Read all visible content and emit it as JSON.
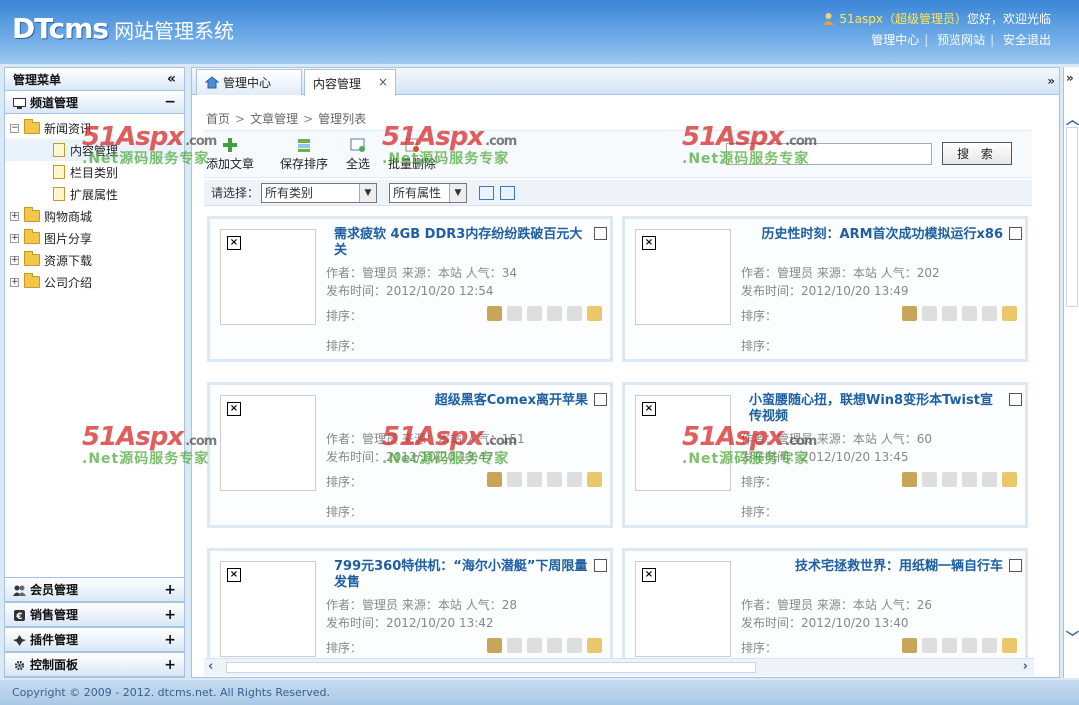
{
  "header": {
    "logo_brand": "DTcms",
    "logo_title": "网站管理系统",
    "user_name": "51aspx",
    "user_role": "（超级管理员）",
    "greeting": "您好，欢迎光临",
    "links": [
      "管理中心",
      "预览网站",
      "安全退出"
    ]
  },
  "sidebar": {
    "title": "管理菜单",
    "collapse_glyph": "«",
    "section": {
      "label": "频道管理",
      "toggle": "−"
    },
    "tree": [
      {
        "label": "新闻资讯",
        "level": 0,
        "expanded": true
      },
      {
        "label": "内容管理",
        "level": 1,
        "selected": true
      },
      {
        "label": "栏目类别",
        "level": 1
      },
      {
        "label": "扩展属性",
        "level": 1
      },
      {
        "label": "购物商城",
        "level": 0,
        "expanded": false
      },
      {
        "label": "图片分享",
        "level": 0,
        "expanded": false
      },
      {
        "label": "资源下载",
        "level": 0,
        "expanded": false
      },
      {
        "label": "公司介绍",
        "level": 0,
        "expanded": false
      }
    ],
    "bottom_sections": [
      {
        "label": "会员管理",
        "toggle": "+",
        "icon": "users-icon"
      },
      {
        "label": "销售管理",
        "toggle": "+",
        "icon": "currency-icon"
      },
      {
        "label": "插件管理",
        "toggle": "+",
        "icon": "plugin-icon"
      },
      {
        "label": "控制面板",
        "toggle": "+",
        "icon": "gear-icon"
      }
    ]
  },
  "tabs": [
    {
      "label": "管理中心",
      "icon": "home-icon"
    },
    {
      "label": "内容管理",
      "active": true,
      "close": "×"
    }
  ],
  "tab_more": "»",
  "breadcrumb": [
    "首页",
    "文章管理",
    "管理列表"
  ],
  "toolbar": {
    "buttons": [
      "添加文章",
      "保存排序",
      "全选",
      "批量删除"
    ],
    "search_value": "",
    "search_button": "搜 索"
  },
  "filter": {
    "label": "请选择：",
    "category": "所有类别",
    "attribute": "所有属性"
  },
  "cards": [
    {
      "title": "需求疲软 4GB DDR3内存纷纷跌破百元大关",
      "author": "作者：管理员",
      "source": "来源：本站",
      "views": "人气：34",
      "date": "发布时间：2012/10/20 12:54"
    },
    {
      "title": "历史性时刻：ARM首次成功模拟运行x86",
      "author": "作者：管理员",
      "source": "来源：本站",
      "views": "人气：202",
      "date": "发布时间：2012/10/20 13:49"
    },
    {
      "title": "超级黑客Comex离开苹果",
      "author": "作者：管理员",
      "source": "来源：本站",
      "views": "人气：151",
      "date": "发布时间：2012/10/20 13:47"
    },
    {
      "title": "小蛮腰随心扭，联想Win8变形本Twist宣传视频",
      "author": "作者：管理员",
      "source": "来源：本站",
      "views": "人气：60",
      "date": "发布时间：2012/10/20 13:45"
    },
    {
      "title": "799元360特供机：“海尔小潜艇”下周限量发售",
      "author": "作者：管理员",
      "source": "来源：本站",
      "views": "人气：28",
      "date": "发布时间：2012/10/20 13:42"
    },
    {
      "title": "技术宅拯救世界：用纸糊一辆自行车",
      "author": "作者：管理员",
      "source": "来源：本站",
      "views": "人气：26",
      "date": "发布时间：2012/10/20 13:40"
    }
  ],
  "card_labels": {
    "sort": "排序："
  },
  "broken_glyph": "×",
  "watermark": {
    "brand": "51Aspx",
    "domain": ".com",
    "slogan": ".Net源码服务专家"
  },
  "footer": "Copyright © 2009 - 2012. dtcms.net. All Rights Reserved.",
  "colors": {
    "accent": "#3b86d6",
    "title": "#1d5fa0",
    "watermark_red": "#d72828",
    "watermark_green": "#50aa3c"
  }
}
